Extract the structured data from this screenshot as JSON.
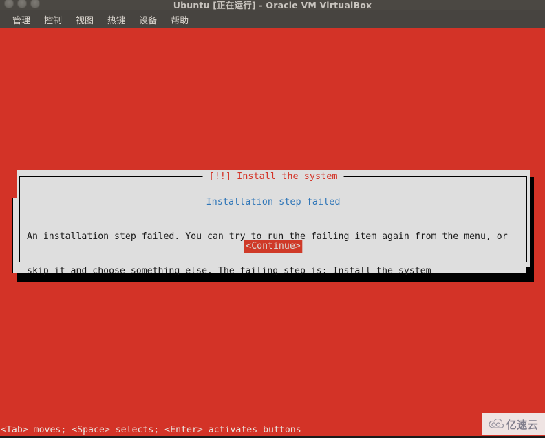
{
  "window": {
    "title": "Ubuntu [正在运行] - Oracle VM VirtualBox",
    "controls": [
      {
        "name": "close",
        "label": ""
      },
      {
        "name": "minimize",
        "label": ""
      },
      {
        "name": "zoom",
        "label": ""
      }
    ],
    "menu": [
      {
        "label": "管理"
      },
      {
        "label": "控制"
      },
      {
        "label": "视图"
      },
      {
        "label": "热键"
      },
      {
        "label": "设备"
      },
      {
        "label": "帮助"
      }
    ]
  },
  "installer": {
    "background_color": "#d33327",
    "dialog": {
      "title": "[!!] Install the system",
      "title_color": "#d33327",
      "heading": "Installation step failed",
      "heading_color": "#2f76b8",
      "body_lines": [
        "An installation step failed. You can try to run the failing item again from the menu, or",
        "skip it and choose something else. The failing step is: Install the system"
      ],
      "buttons": [
        {
          "label": "<Continue>",
          "selected": true,
          "bg_color": "#cf3a28",
          "fg_color": "#dcd7d2"
        }
      ]
    },
    "help_bar": "<Tab> moves; <Space> selects; <Enter> activates buttons"
  },
  "watermark": {
    "icon": "cloud-icon",
    "text": "亿速云"
  }
}
